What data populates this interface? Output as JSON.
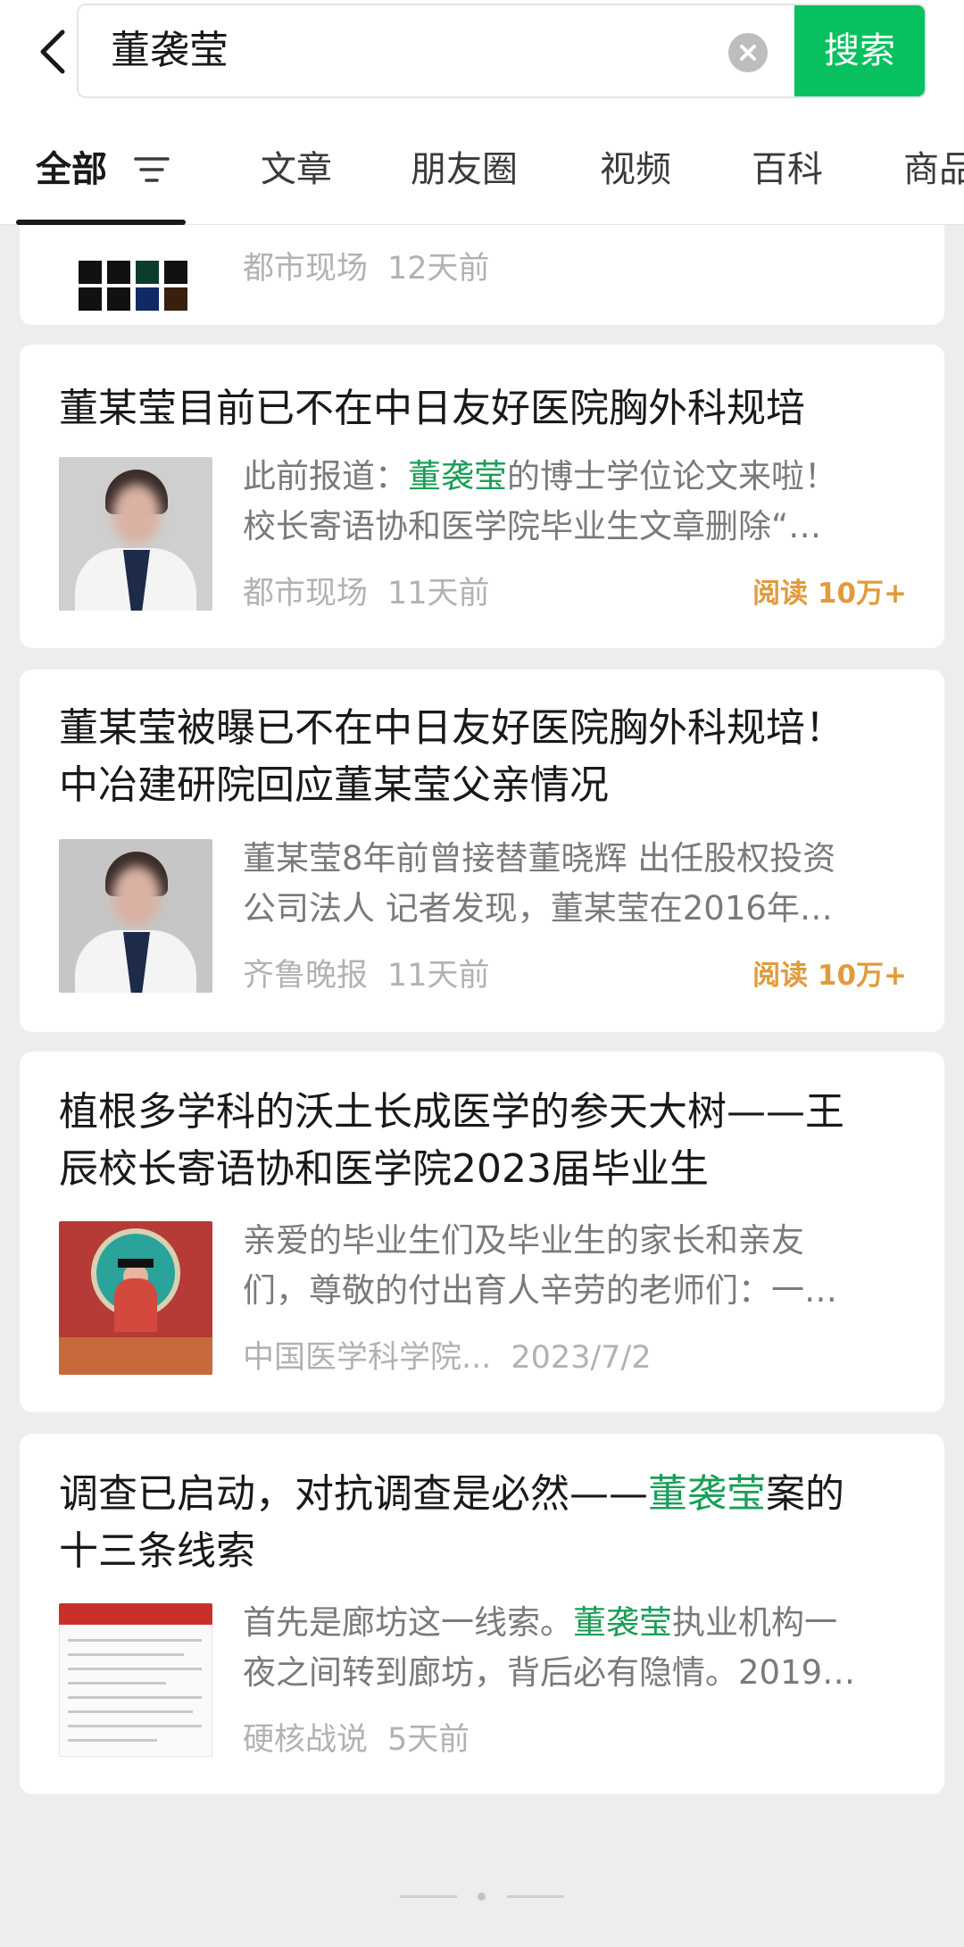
{
  "search": {
    "query": "董袭莹",
    "button_label": "搜索"
  },
  "tabs": [
    {
      "label": "全部",
      "active": true
    },
    {
      "label": "文章"
    },
    {
      "label": "朋友圈"
    },
    {
      "label": "视频"
    },
    {
      "label": "百科"
    },
    {
      "label": "商品"
    }
  ],
  "results": [
    {
      "source": "都市现场",
      "time": "12天前"
    },
    {
      "title": "董某莹目前已不在中日友好医院胸外科规培",
      "snippet_line1_before": "此前报道：",
      "snippet_line1_highlight": "董袭莹",
      "snippet_line1_after": "的博士学位论文来啦！",
      "snippet_line2": "校长寄语协和医学院毕业生文章删除“…",
      "source": "都市现场",
      "time": "11天前",
      "reads": "阅读 10万+"
    },
    {
      "title_line1": "董某莹被曝已不在中日友好医院胸外科规培！",
      "title_line2": "中冶建研院回应董某莹父亲情况",
      "snippet_line1": "董某莹8年前曾接替董晓辉 出任股权投资",
      "snippet_line2": "公司法人 记者发现，董某莹在2016年…",
      "source": "齐鲁晚报",
      "time": "11天前",
      "reads": "阅读 10万+"
    },
    {
      "title_line1": "植根多学科的沃土长成医学的参天大树——王",
      "title_line2": "辰校长寄语协和医学院2023届毕业生",
      "snippet_line1": "亲爱的毕业生们及毕业生的家长和亲友",
      "snippet_line2": "们，尊敬的付出育人辛劳的老师们：一…",
      "source": "中国医学科学院...",
      "time": "2023/7/2"
    },
    {
      "title_line1_before": "调查已启动，对抗调查是必然——",
      "title_line1_highlight": "董袭莹",
      "title_line1_after": "案的",
      "title_line2": "十三条线索",
      "snippet_line1_before": "首先是廊坊这一线索。",
      "snippet_line1_highlight": "董袭莹",
      "snippet_line1_after": "执业机构一",
      "snippet_line2": "夜之间转到廊坊，背后必有隐情。2019…",
      "source": "硬核战说",
      "time": "5天前"
    }
  ],
  "colors": {
    "accent": "#07c160",
    "highlight": "#1a9e57",
    "reads": "#e19b3c"
  },
  "icons": [
    "back-arrow-icon",
    "clear-icon",
    "filter-icon"
  ]
}
